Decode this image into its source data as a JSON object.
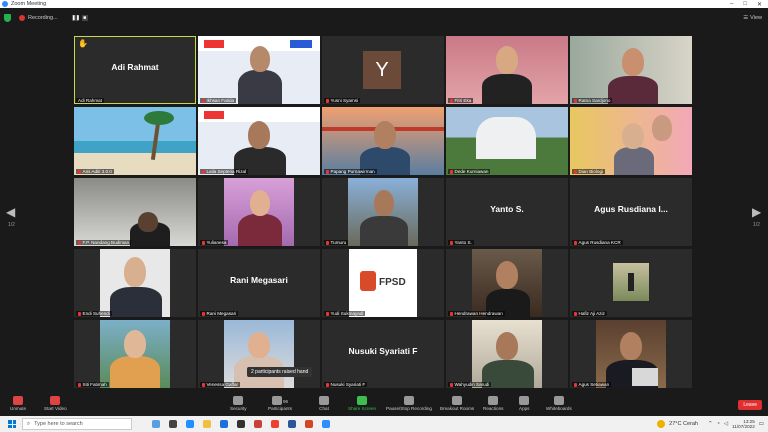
{
  "window": {
    "title": "Zoom Meeting"
  },
  "meeting_bar": {
    "recording_label": "Recording...",
    "view_label": "View"
  },
  "navigation": {
    "page_indicator_left": "1/2",
    "page_indicator_right": "1/2"
  },
  "tiles": [
    {
      "name": "Adi Rahmat",
      "display": "Adi Rahmat",
      "show_name": true,
      "muted": false
    },
    {
      "name": "Ikhsan Fatida",
      "muted": true
    },
    {
      "name": "Yusni Syamsi",
      "avatar_letter": "Y",
      "muted": true
    },
    {
      "name": "Fitri Eka",
      "muted": true
    },
    {
      "name": "Ratna Sardjono",
      "muted": true
    },
    {
      "name": "Ami Aditi 3.0.0",
      "muted": true
    },
    {
      "name": "Laila Septeria Rizal",
      "muted": true
    },
    {
      "name": "Papang Purnawirman",
      "muted": true
    },
    {
      "name": "Dede Kurniawan",
      "muted": true
    },
    {
      "name": "Dian Biologi",
      "muted": true
    },
    {
      "name": "F.P. Nandang Budiman",
      "muted": true
    },
    {
      "name": "Yulianesa",
      "muted": true
    },
    {
      "name": "Tumuru",
      "muted": true
    },
    {
      "name": "Yanto S.",
      "display": "Yanto S.",
      "show_name": true,
      "muted": true
    },
    {
      "name": "Agus Rusdiana KCR",
      "display": "Agus Rusdiana I...",
      "show_name": true,
      "muted": true
    },
    {
      "name": "Endi Suhendi",
      "muted": true
    },
    {
      "name": "Rani Megasari",
      "display": "Rani Megasari",
      "show_name": true,
      "muted": true
    },
    {
      "name": "Yudi Sukmayadi",
      "logo_text": "FPSD",
      "muted": true
    },
    {
      "name": "Hendrawan Hendrawan",
      "muted": true
    },
    {
      "name": "Hafiz Aji Aziz",
      "muted": true
    },
    {
      "name": "Siti Fatimah",
      "muted": true
    },
    {
      "name": "Venessa Gaffar",
      "muted": true
    },
    {
      "name": "Nusuki Syariati F",
      "display": "Nusuki Syariati F",
      "show_name": true,
      "muted": true
    },
    {
      "name": "Wahyudin Sarudi",
      "muted": true
    },
    {
      "name": "Agus Setiawan",
      "muted": true
    }
  ],
  "tooltip": {
    "text": "2 participants raised hand"
  },
  "toolbar": {
    "unmute": "Unmute",
    "start_video": "Start Video",
    "security": "Security",
    "participants": "Participants",
    "participants_count": "96",
    "chat": "Chat",
    "share_screen": "Share Screen",
    "pause_recording": "Pause/Stop Recording",
    "breakout_rooms": "Breakout Rooms",
    "reactions": "Reactions",
    "apps": "Apps",
    "whiteboards": "Whiteboards",
    "leave": "Leave"
  },
  "taskbar": {
    "search_placeholder": "Type here to search",
    "weather": "27°C  Cerah",
    "time": "13:25",
    "date": "11/07/2022"
  },
  "colors": {
    "active_speaker": "#c6d94a",
    "leave": "#e02f2f",
    "share_screen": "#3cbf4f"
  }
}
